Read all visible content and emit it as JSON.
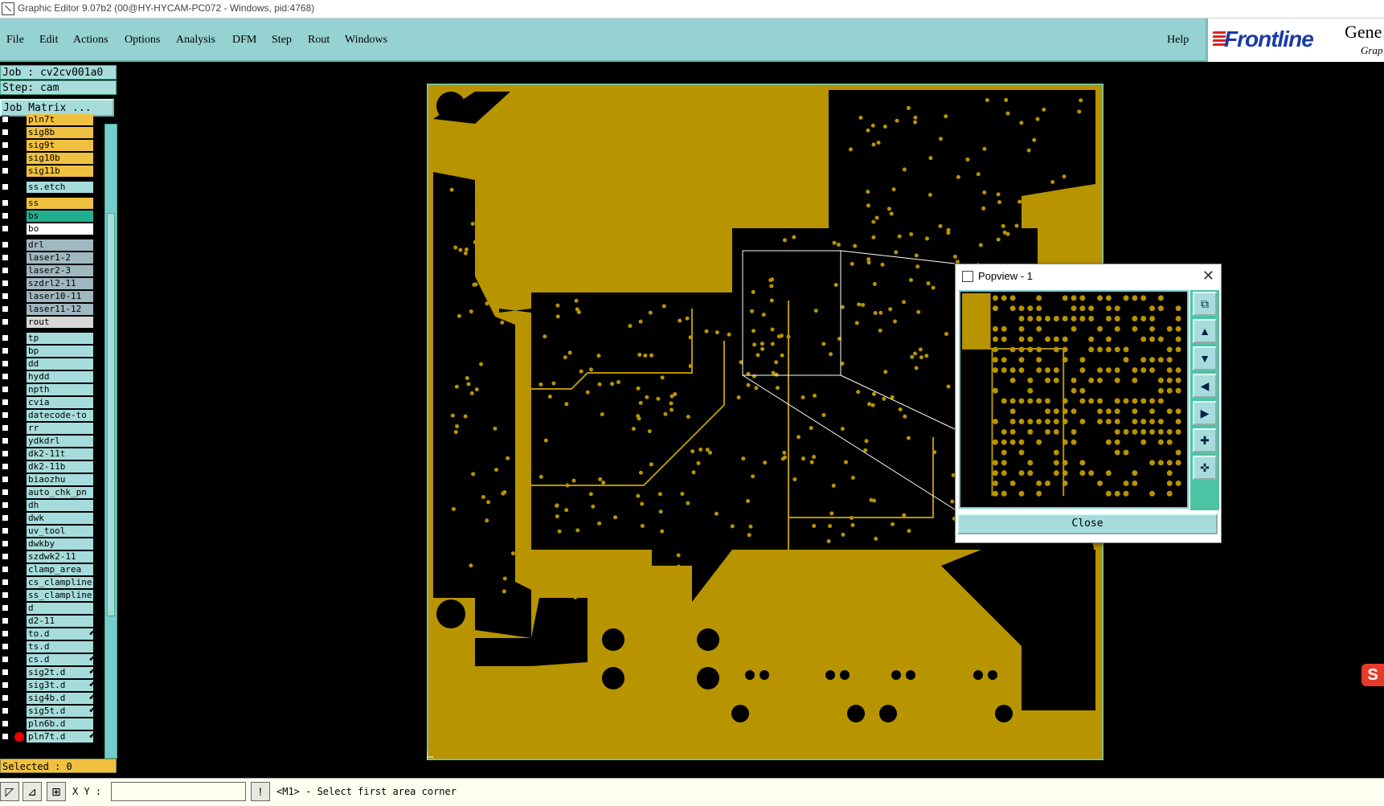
{
  "window": {
    "title": "Graphic Editor 9.07b2 (00@HY-HYCAM-PC072 - Windows, pid:4768)"
  },
  "menu": [
    "File",
    "Edit",
    "Actions",
    "Options",
    "Analysis",
    "DFM",
    "Step",
    "Rout",
    "Windows"
  ],
  "help": "Help",
  "logo": {
    "brand": "Frontline",
    "product": "Gene",
    "sub": "Grap"
  },
  "job": {
    "label": "Job : cv2cv001a0",
    "step": "Step: cam"
  },
  "job_matrix": "Job Matrix ...",
  "layers": [
    {
      "name": "pln7t",
      "color": "#f0c040"
    },
    {
      "name": "sig8b",
      "color": "#f0c040"
    },
    {
      "name": "sig9t",
      "color": "#f0c040"
    },
    {
      "name": "sig10b",
      "color": "#f0c040"
    },
    {
      "name": "sig11b",
      "color": "#f0c040"
    },
    {
      "name": "ss.etch",
      "color": "#a7dcdc"
    },
    {
      "name": "ss",
      "color": "#f0c040"
    },
    {
      "name": "bs",
      "color": "#20b090"
    },
    {
      "name": "bo",
      "color": "#ffffff"
    },
    {
      "name": "drl",
      "color": "#a0b8c0"
    },
    {
      "name": "laser1-2",
      "color": "#a0b8c0"
    },
    {
      "name": "laser2-3",
      "color": "#a0b8c0"
    },
    {
      "name": "szdrl2-11",
      "color": "#a0b8c0"
    },
    {
      "name": "laser10-11",
      "color": "#a0b8c0"
    },
    {
      "name": "laser11-12",
      "color": "#a0b8c0"
    },
    {
      "name": "rout",
      "color": "#d8d8d8"
    },
    {
      "name": "tp",
      "color": "#a7dcdc"
    },
    {
      "name": "bp",
      "color": "#a7dcdc"
    },
    {
      "name": "dd",
      "color": "#a7dcdc"
    },
    {
      "name": "hydd",
      "color": "#a7dcdc"
    },
    {
      "name": "npth",
      "color": "#a7dcdc"
    },
    {
      "name": "cvia",
      "color": "#a7dcdc"
    },
    {
      "name": "datecode-to",
      "color": "#a7dcdc"
    },
    {
      "name": "rr",
      "color": "#a7dcdc"
    },
    {
      "name": "ydkdrl",
      "color": "#a7dcdc"
    },
    {
      "name": "dk2-11t",
      "color": "#a7dcdc"
    },
    {
      "name": "dk2-11b",
      "color": "#a7dcdc"
    },
    {
      "name": "biaozhu",
      "color": "#a7dcdc"
    },
    {
      "name": "auto_chk_pn",
      "color": "#a7dcdc"
    },
    {
      "name": "dh",
      "color": "#a7dcdc"
    },
    {
      "name": "dwk",
      "color": "#a7dcdc"
    },
    {
      "name": "uv_tool",
      "color": "#a7dcdc"
    },
    {
      "name": "dwkby",
      "color": "#a7dcdc"
    },
    {
      "name": "szdwk2-11",
      "color": "#a7dcdc"
    },
    {
      "name": "clamp_area",
      "color": "#a7dcdc"
    },
    {
      "name": "cs_clampline",
      "color": "#a7dcdc"
    },
    {
      "name": "ss_clampline",
      "color": "#a7dcdc"
    },
    {
      "name": "d",
      "color": "#a7dcdc"
    },
    {
      "name": "d2-11",
      "color": "#a7dcdc"
    },
    {
      "name": "to.d",
      "color": "#a7dcdc",
      "arrow": true
    },
    {
      "name": "ts.d",
      "color": "#a7dcdc"
    },
    {
      "name": "cs.d",
      "color": "#a7dcdc",
      "arrow": true
    },
    {
      "name": "sig2t.d",
      "color": "#a7dcdc",
      "arrow": true
    },
    {
      "name": "sig3t.d",
      "color": "#a7dcdc",
      "arrow": true
    },
    {
      "name": "sig4b.d",
      "color": "#a7dcdc",
      "arrow": true
    },
    {
      "name": "sig5t.d",
      "color": "#a7dcdc",
      "arrow": true
    },
    {
      "name": "pln6b.d",
      "color": "#a7dcdc"
    },
    {
      "name": "pln7t.d",
      "color": "#a7dcdc",
      "arrow": true,
      "active": true
    }
  ],
  "selected": "Selected : 0",
  "status": {
    "xy_label": "X Y :",
    "xy_value": "",
    "prompt": "<M1> - Select first area corner"
  },
  "popview": {
    "title": "Popview - 1",
    "close": "Close"
  },
  "colors": {
    "board": "#b89400",
    "outline": "#a7dcdc",
    "panel": "#96d2d2"
  }
}
